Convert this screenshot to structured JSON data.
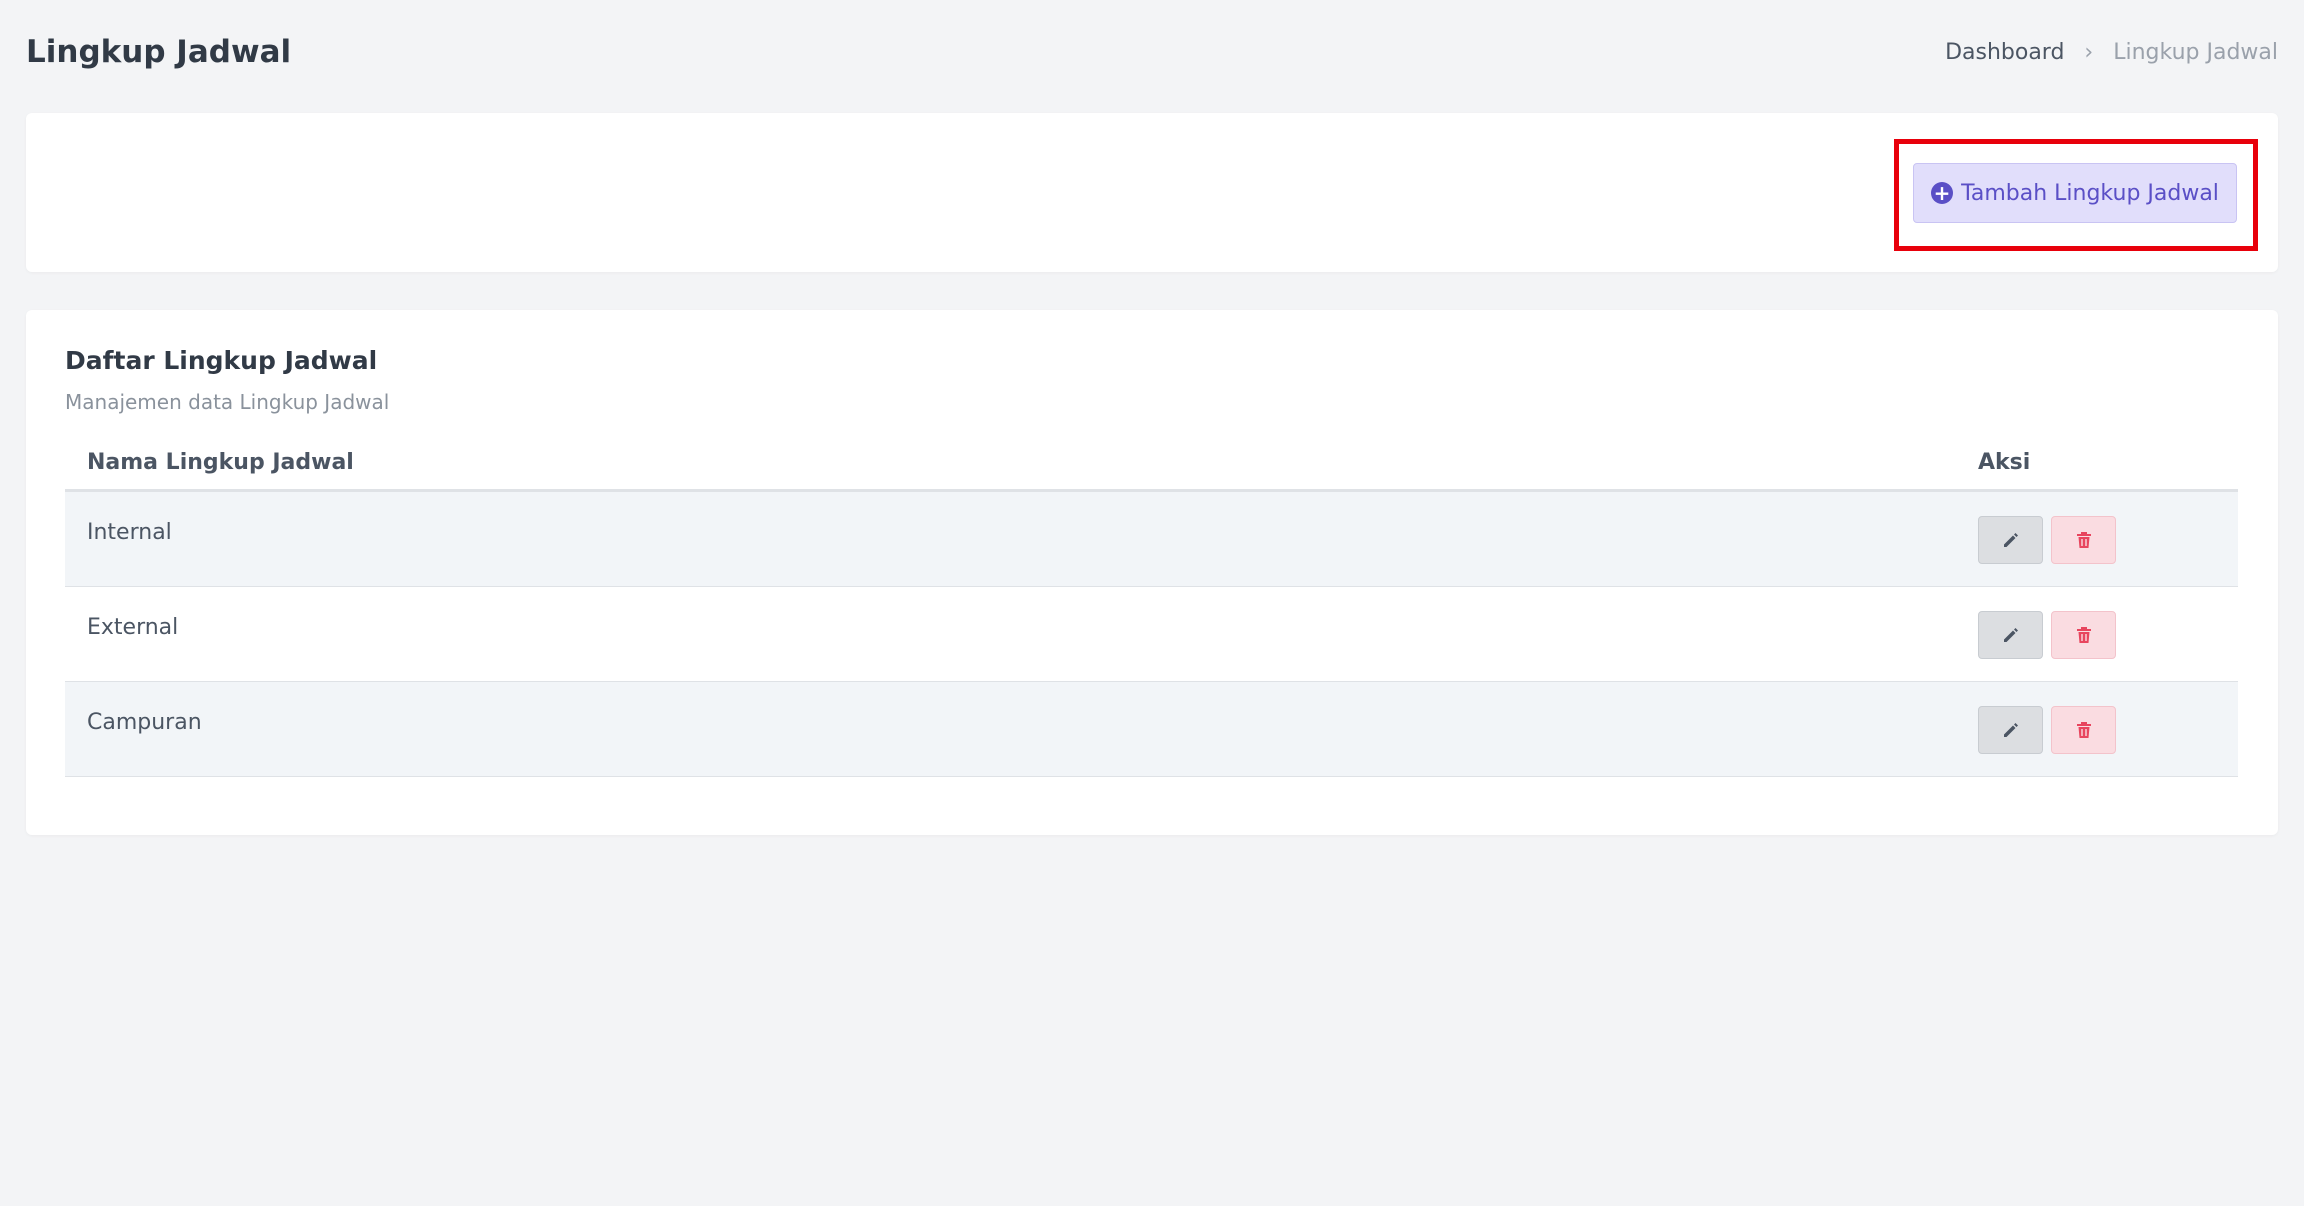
{
  "header": {
    "title": "Lingkup Jadwal",
    "breadcrumb": {
      "home": "Dashboard",
      "separator": "›",
      "current": "Lingkup Jadwal"
    }
  },
  "toolbar": {
    "add_label": "Tambah Lingkup Jadwal",
    "add_icon": "plus-circle-icon"
  },
  "list": {
    "title": "Daftar Lingkup Jadwal",
    "subtitle": "Manajemen data Lingkup Jadwal",
    "columns": [
      "Nama Lingkup Jadwal",
      "Aksi"
    ],
    "rows": [
      {
        "name": "Internal"
      },
      {
        "name": "External"
      },
      {
        "name": "Campuran"
      }
    ],
    "row_actions": {
      "edit_icon": "pencil-icon",
      "delete_icon": "trash-icon"
    }
  },
  "colors": {
    "accent": "#5a4fc6",
    "accent_bg": "#e1defb",
    "danger": "#e8455e",
    "highlight": "#e8000b"
  }
}
